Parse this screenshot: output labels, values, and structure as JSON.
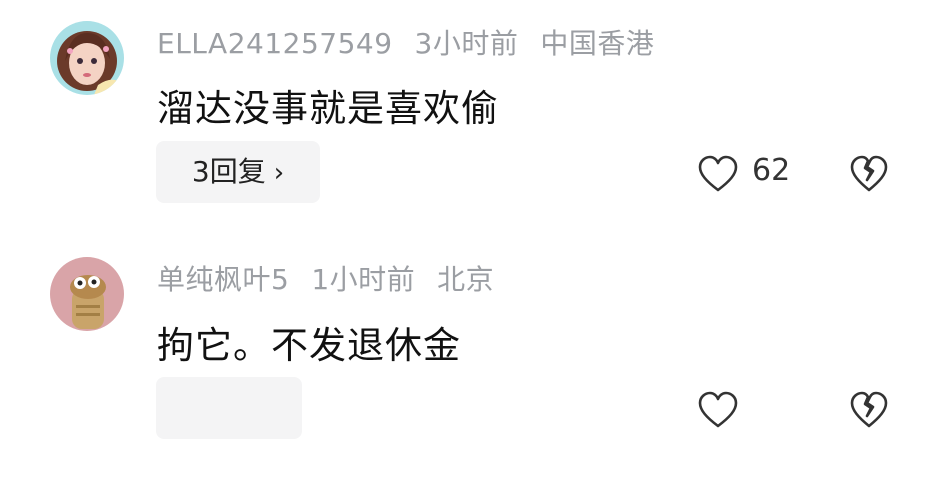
{
  "comments": [
    {
      "username": "ELLA241257549",
      "time": "3小时前",
      "location": "中国香港",
      "text": "溜达没事就是喜欢偷",
      "reply_label": "3回复",
      "reply_chevron": "›",
      "like_count": "62"
    },
    {
      "username": "单纯枫叶5",
      "time": "1小时前",
      "location": "北京",
      "text": "拘它。不发退休金"
    }
  ],
  "icons": {
    "like": "heart-outline-icon",
    "dislike": "broken-heart-icon"
  },
  "colors": {
    "meta_text": "#9b9ea3",
    "body_text": "#111111",
    "reply_bg": "#f4f4f5"
  }
}
